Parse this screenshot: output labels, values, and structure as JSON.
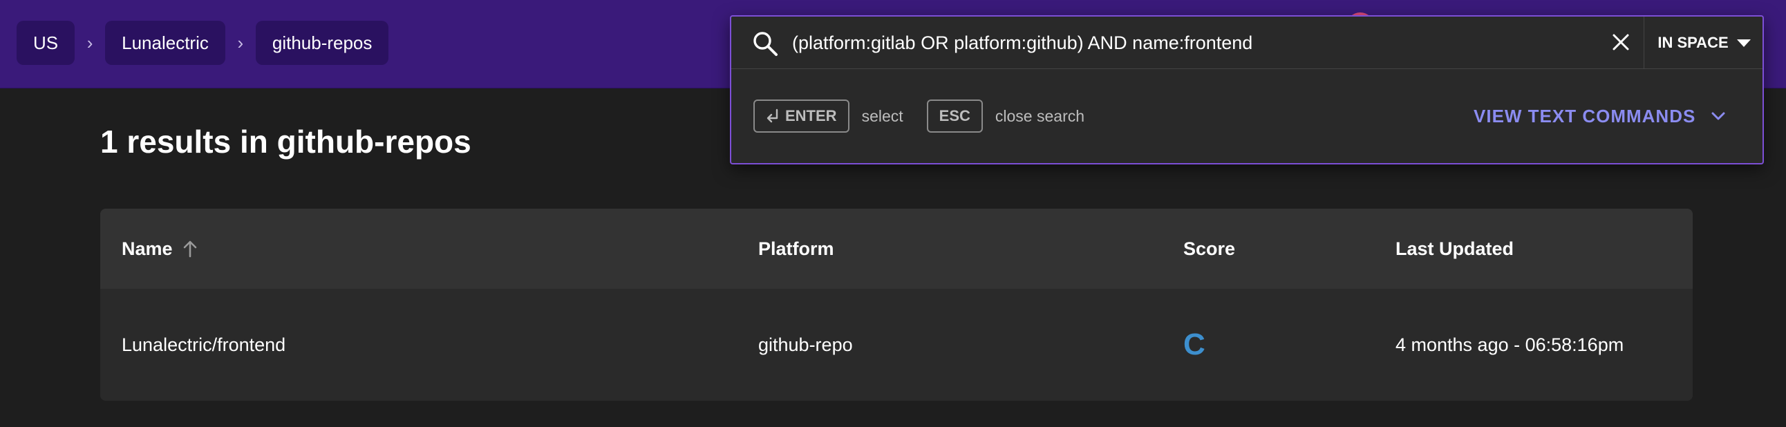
{
  "breadcrumb": {
    "items": [
      {
        "label": "US"
      },
      {
        "label": "Lunalectric"
      },
      {
        "label": "github-repos"
      }
    ],
    "separator": "›"
  },
  "results": {
    "heading": "1 results in github-repos"
  },
  "table": {
    "columns": [
      "Name",
      "Platform",
      "Score",
      "Last Updated"
    ],
    "rows": [
      {
        "name": "Lunalectric/frontend",
        "platform": "github-repo",
        "score": "C",
        "last_updated": "4 months ago - 06:58:16pm"
      }
    ]
  },
  "search": {
    "query": "(platform:gitlab OR platform:github) AND name:frontend",
    "scope_label": "IN SPACE",
    "hints": [
      {
        "key": "ENTER",
        "text": "select"
      },
      {
        "key": "ESC",
        "text": "close search"
      }
    ],
    "view_commands_label": "VIEW TEXT COMMANDS"
  },
  "colors": {
    "topbar": "#3a1a7a",
    "accent_border": "#7d4fd6",
    "score_c": "#3d8fce",
    "link": "#8b8cf0"
  },
  "icons": [
    "search-icon",
    "close-icon",
    "caret-down-icon",
    "enter-key-icon",
    "chevron-down-icon",
    "sort-ascending-icon"
  ]
}
